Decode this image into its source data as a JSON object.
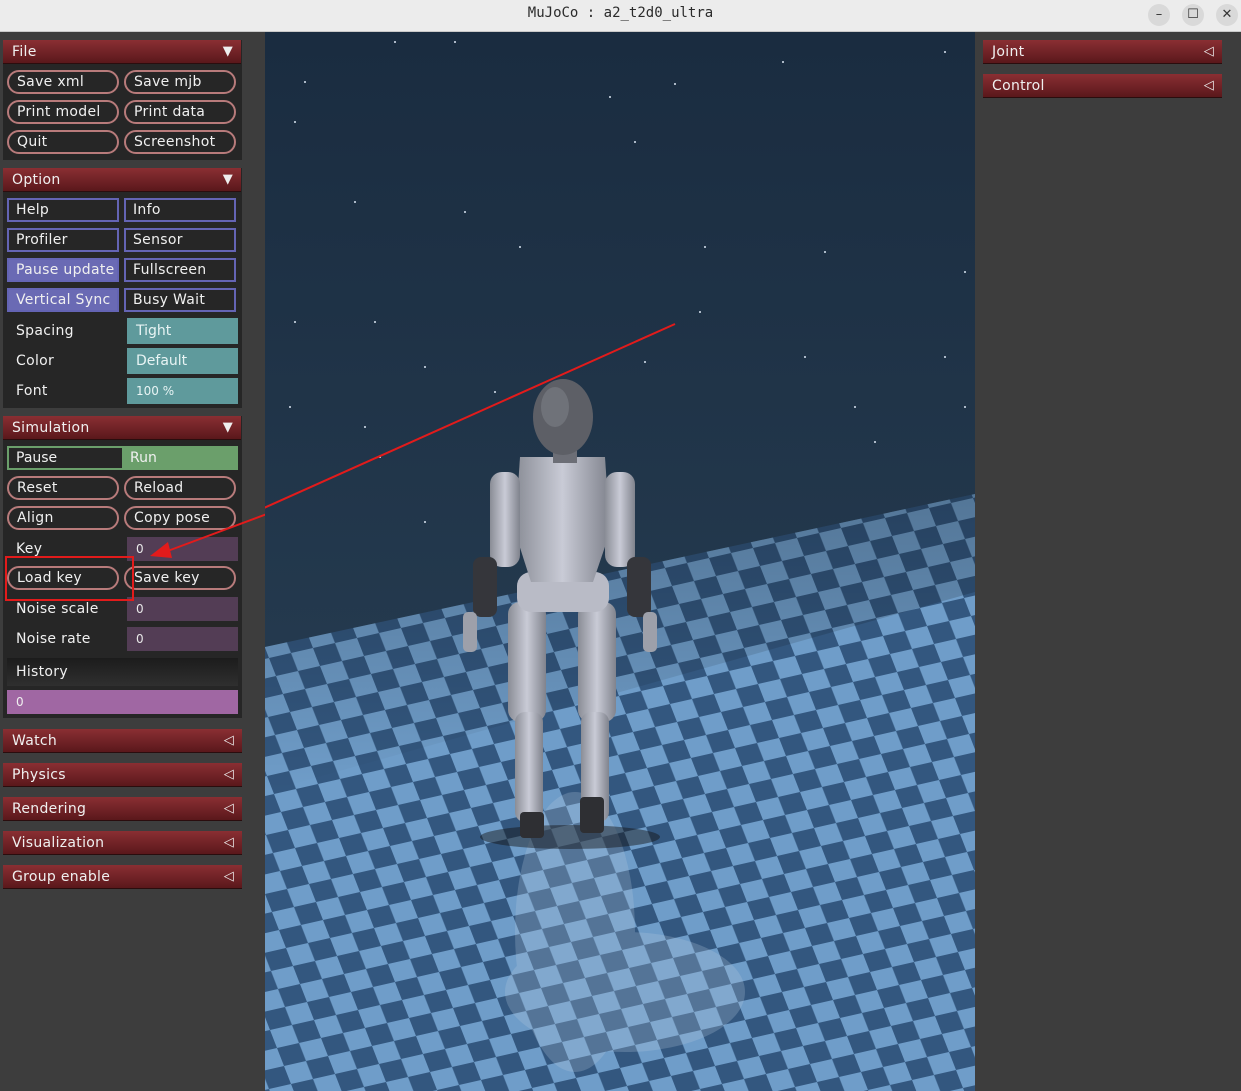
{
  "window": {
    "title": "MuJoCo : a2_t2d0_ultra",
    "minimize": "–",
    "maximize": "☐",
    "close": "✕"
  },
  "left_panel": {
    "file": {
      "header": "File",
      "buttons": [
        "Save xml",
        "Save mjb",
        "Print model",
        "Print data",
        "Quit",
        "Screenshot"
      ]
    },
    "option": {
      "header": "Option",
      "checkboxes": [
        {
          "label": "Help",
          "on": false
        },
        {
          "label": "Info",
          "on": false
        },
        {
          "label": "Profiler",
          "on": false
        },
        {
          "label": "Sensor",
          "on": false
        },
        {
          "label": "Pause update",
          "on": true
        },
        {
          "label": "Fullscreen",
          "on": false
        },
        {
          "label": "Vertical Sync",
          "on": true
        },
        {
          "label": "Busy Wait",
          "on": false
        }
      ],
      "spacing_label": "Spacing",
      "spacing_value": "Tight",
      "color_label": "Color",
      "color_value": "Default",
      "font_label": "Font",
      "font_value": "100 %"
    },
    "simulation": {
      "header": "Simulation",
      "pause": "Pause",
      "run": "Run",
      "reset": "Reset",
      "reload": "Reload",
      "align": "Align",
      "copy_pose": "Copy pose",
      "key_label": "Key",
      "key_value": "0",
      "load_key": "Load key",
      "save_key": "Save key",
      "noise_scale_label": "Noise scale",
      "noise_scale_value": "0",
      "noise_rate_label": "Noise rate",
      "noise_rate_value": "0",
      "history_label": "History",
      "history_value": "0"
    },
    "collapsed": [
      "Watch",
      "Physics",
      "Rendering",
      "Visualization",
      "Group enable"
    ]
  },
  "right_panel": {
    "collapsed": [
      "Joint",
      "Control"
    ]
  },
  "colors": {
    "header_red": "#8a2f33",
    "annotation_red": "#e21b1b",
    "teal": "#5f9a9c",
    "checkbox_on": "#6a6ab4",
    "run_green": "#6b9f6b",
    "history_purple": "#a067a3"
  }
}
